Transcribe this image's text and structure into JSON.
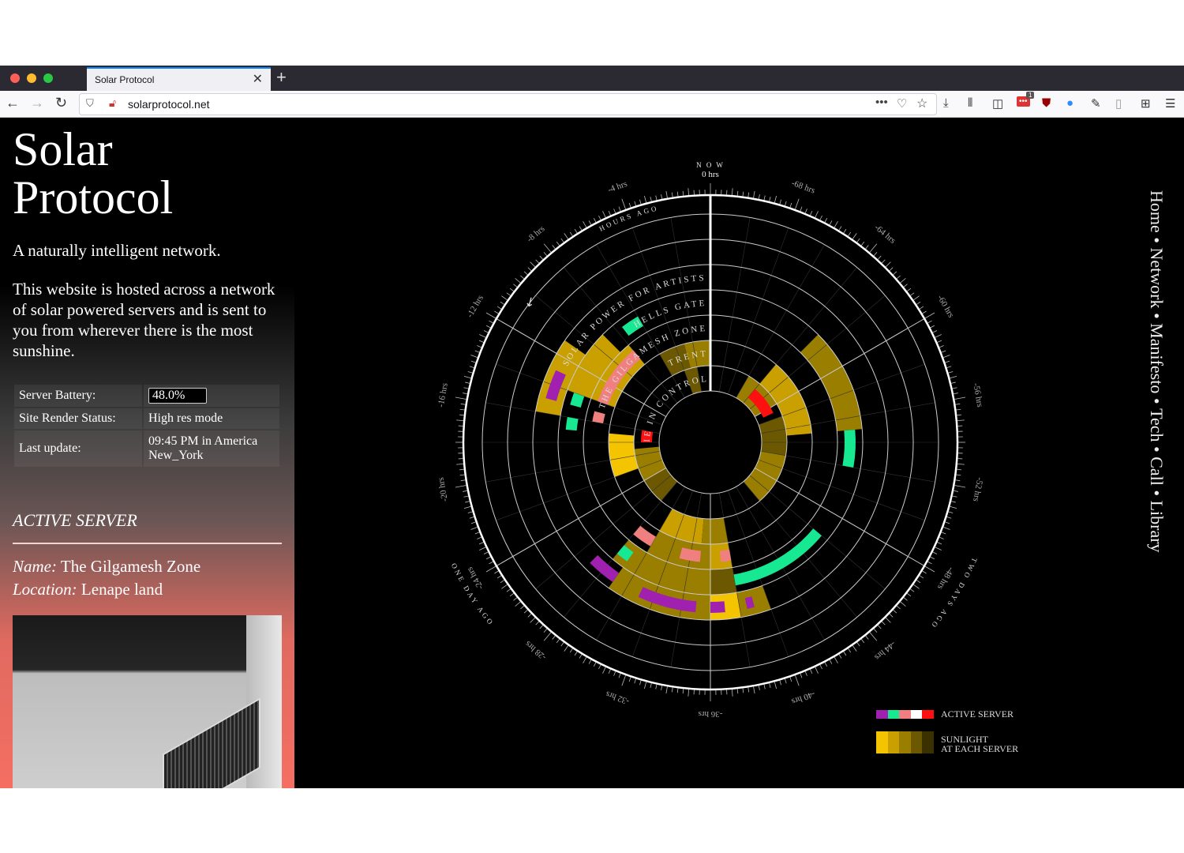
{
  "browser": {
    "tab_title": "Solar Protocol",
    "url": "solarprotocol.net",
    "toolbar_icons": [
      "more-icon",
      "pocket-icon",
      "bookmark-star-icon",
      "download-icon",
      "library-icon",
      "sidebar-icon",
      "extension-badge-icon",
      "ublock-icon",
      "zoom-icon",
      "pin-icon",
      "reader-icon",
      "gift-icon",
      "menu-icon"
    ],
    "extension_badge_count": "1"
  },
  "sidebar": {
    "title_line1": "Solar",
    "title_line2": "Protocol",
    "tagline": "A naturally intelligent network.",
    "description": "This website is hosted across a network of solar powered servers and is sent to you from wherever there is the most sunshine.",
    "stats": [
      {
        "label": "Server Battery:",
        "value": "48.0%"
      },
      {
        "label": "Site Render Status:",
        "value": "High res mode"
      },
      {
        "label": "Last update:",
        "value": "09:45 PM in America New_York"
      }
    ],
    "active_server_heading": "ACTIVE SERVER",
    "name_label": "Name:",
    "name_value": "The Gilgamesh Zone",
    "location_label": "Location:",
    "location_value": "Lenape land"
  },
  "nav": {
    "items": [
      "Home",
      "Network",
      "Manifesto",
      "Tech",
      "Call",
      "Library"
    ],
    "separator": "•"
  },
  "legend": {
    "active_label": "ACTIVE SERVER",
    "active_colors": [
      "#a020b0",
      "#17e892",
      "#f08080",
      "#ffffff",
      "#ff1010"
    ],
    "sunlight_label_1": "SUNLIGHT",
    "sunlight_label_2": "AT EACH SERVER",
    "sunlight_colors": [
      "#f5c400",
      "#c9a000",
      "#9a7e00",
      "#6b5800",
      "#3a3000"
    ]
  },
  "chart_data": {
    "type": "heatmap",
    "title": "",
    "now_label_1": "N O W",
    "now_label_2": "0 hrs",
    "arc_labels": {
      "hours_ago": "HOURS AGO",
      "one_day": "ONE DAY AGO",
      "two_days": "TWO DAYS AGO"
    },
    "hours_range": [
      0,
      72
    ],
    "tick_labels": [
      "-4 hrs",
      "-8 hrs",
      "-12 hrs",
      "-16 hrs",
      "-20 hrs",
      "-24 hrs",
      "-28 hrs",
      "-32 hrs",
      "-36 hrs",
      "-40 hrs",
      "-44 hrs",
      "-48 hrs",
      "-52 hrs",
      "-56 hrs",
      "-60 hrs",
      "-64 hrs",
      "-68 hrs"
    ],
    "servers": [
      {
        "name": "CADDIE IN CONTROL",
        "color": "#ff1010",
        "sunlight": [
          [
            0,
            0,
            0.2
          ],
          [
            2,
            4,
            0.3
          ],
          [
            19,
            24,
            0.6
          ],
          [
            24,
            28,
            0.3
          ],
          [
            44,
            52,
            0.5
          ],
          [
            52,
            58,
            0.3
          ],
          [
            60,
            66,
            0.6
          ]
        ],
        "active": [
          [
            16,
            18
          ],
          [
            59,
            64
          ]
        ]
      },
      {
        "name": "TRENT",
        "color": "#ffffff",
        "sunlight": [
          [
            0,
            3,
            0.5
          ],
          [
            3,
            6,
            0.25
          ],
          [
            17,
            22,
            0.9
          ],
          [
            30,
            35,
            0.7
          ],
          [
            35,
            38,
            0.5
          ],
          [
            55,
            64,
            0.7
          ]
        ],
        "active": []
      },
      {
        "name": "THE GILGAMESH ZONE",
        "color": "#f08080",
        "sunlight": [
          [
            8,
            14,
            0.8
          ],
          [
            30,
            36,
            0.6
          ],
          [
            36,
            38,
            0.8
          ]
        ],
        "active": [
          [
            8,
            14
          ],
          [
            15,
            16
          ],
          [
            28,
            30
          ],
          [
            33,
            35
          ],
          [
            37,
            38
          ]
        ]
      },
      {
        "name": "HELLS GATE",
        "color": "#17e892",
        "sunlight": [
          [
            9,
            14,
            0.7
          ],
          [
            28,
            32,
            0.4
          ],
          [
            32,
            36,
            0.6
          ],
          [
            36,
            38,
            0.3
          ],
          [
            55,
            63,
            0.6
          ]
        ],
        "active": [
          [
            6,
            7.5
          ],
          [
            14,
            15
          ],
          [
            16,
            17
          ],
          [
            28,
            29
          ],
          [
            38,
            46
          ],
          [
            52,
            55
          ]
        ]
      },
      {
        "name": "SOLAR POWER FOR ARTISTS",
        "color": "#a020b0",
        "sunlight": [
          [
            11,
            16,
            0.7
          ],
          [
            29,
            36,
            0.6
          ],
          [
            36,
            38,
            0.9
          ],
          [
            38,
            40,
            0.4
          ]
        ],
        "active": [
          [
            13,
            15
          ],
          [
            27,
            29
          ],
          [
            31,
            35
          ],
          [
            36,
            37
          ],
          [
            38.5,
            39
          ]
        ]
      }
    ]
  }
}
